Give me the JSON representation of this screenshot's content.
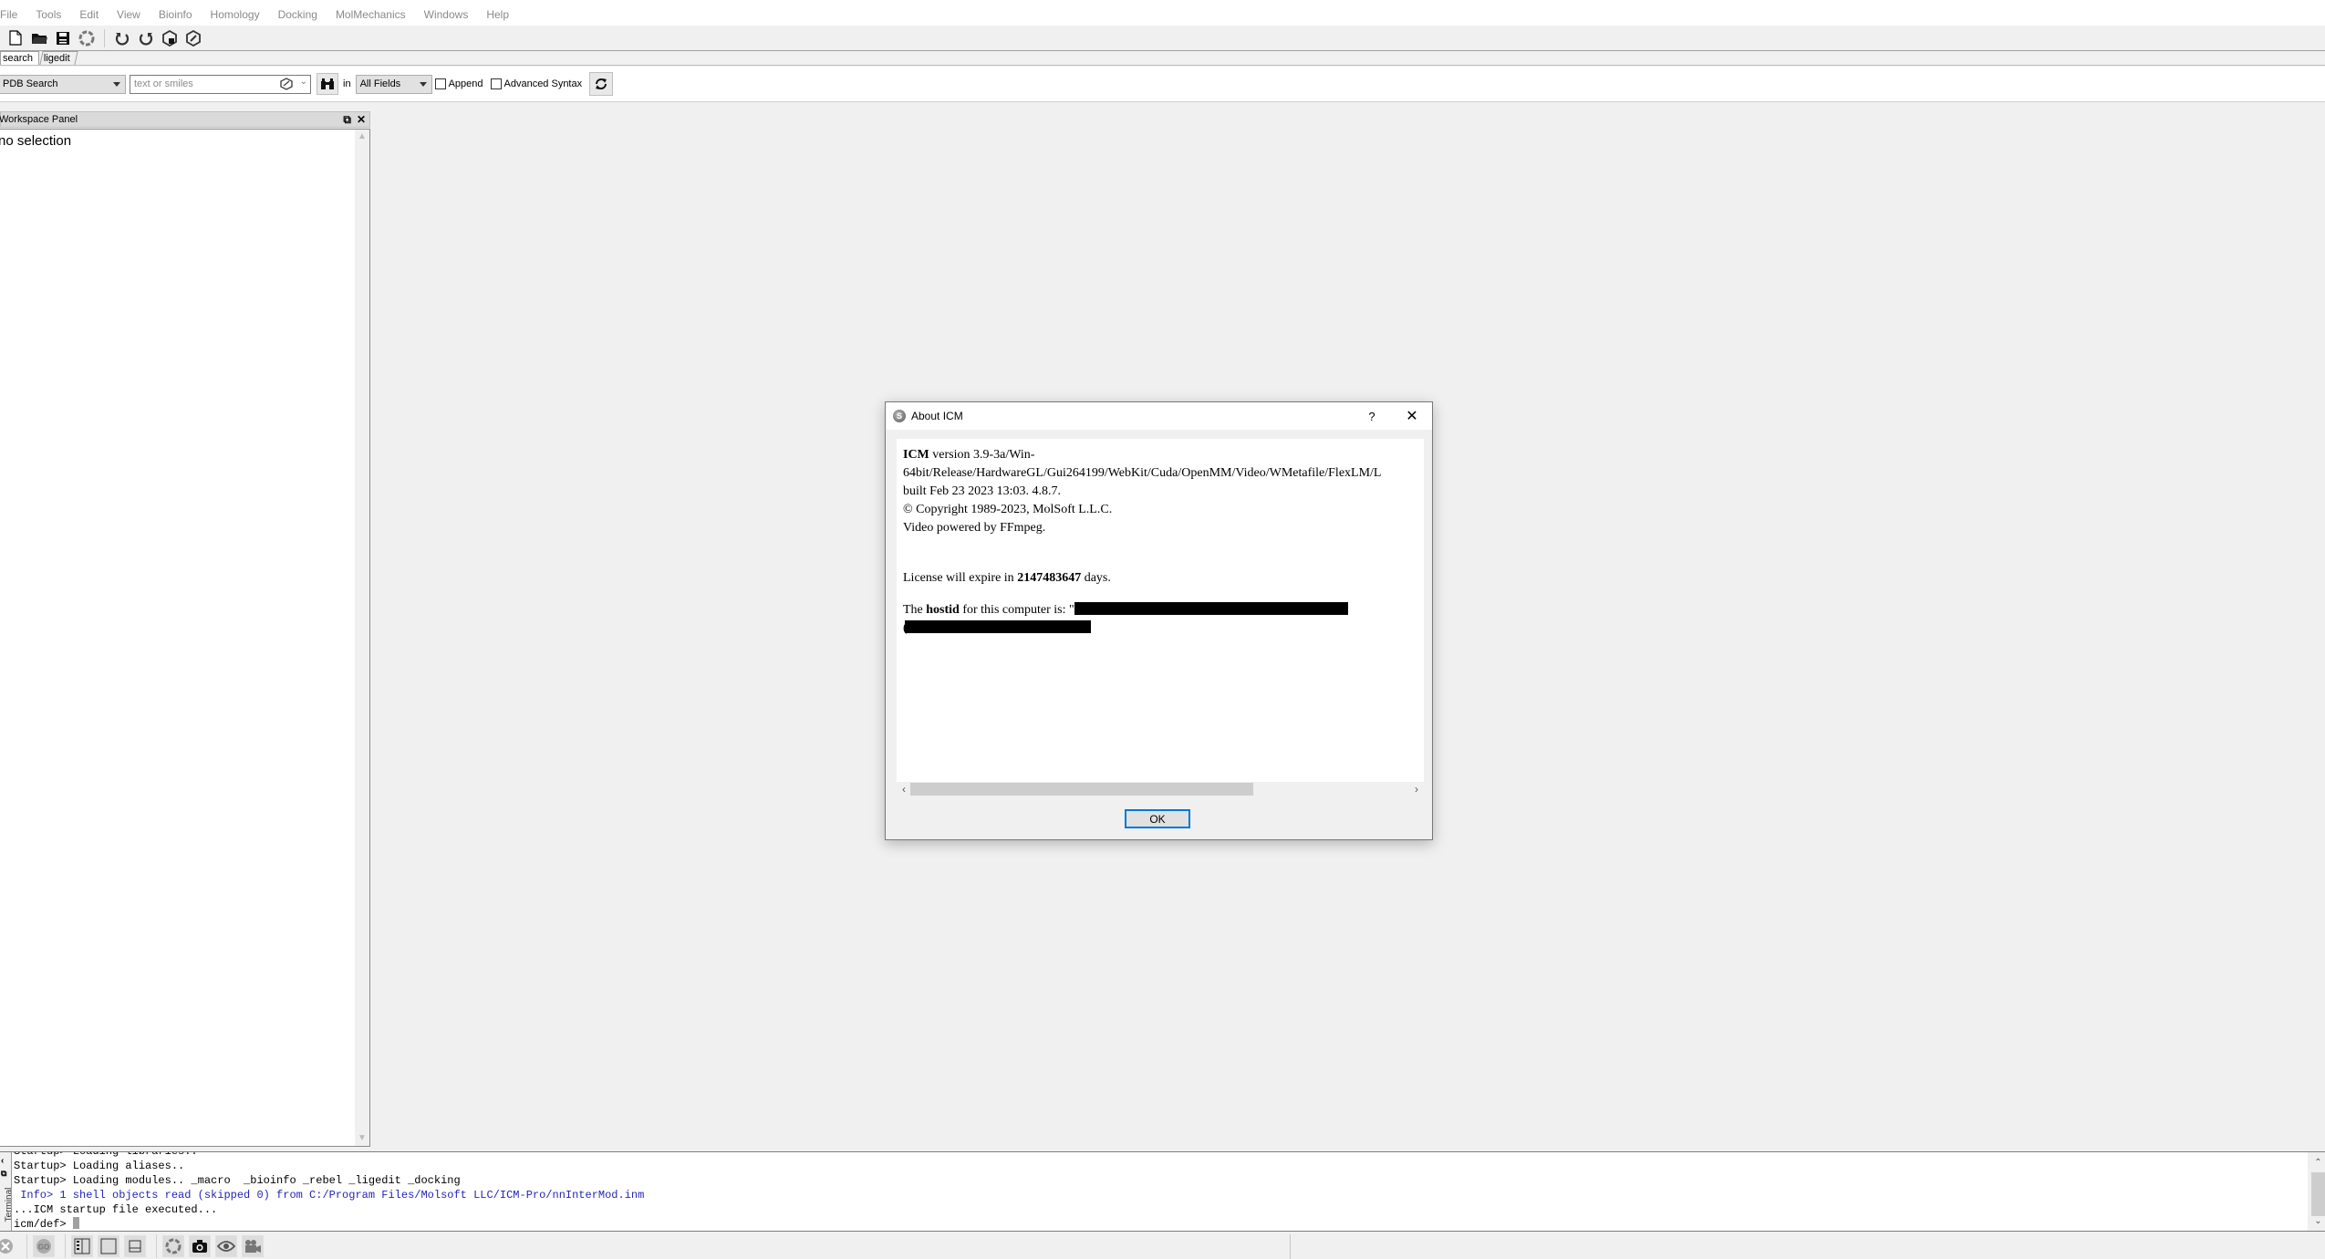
{
  "menubar": {
    "items": [
      "File",
      "Tools",
      "Edit",
      "View",
      "Bioinfo",
      "Homology",
      "Docking",
      "MolMechanics",
      "Windows",
      "Help"
    ]
  },
  "toolbar": {
    "icons": [
      "new-file-icon",
      "open-folder-icon",
      "save-icon",
      "molecule-icon",
      "undo-icon",
      "redo-icon",
      "search-structure-icon",
      "ligand-editor-icon"
    ]
  },
  "tabs": [
    {
      "label": "search",
      "active": true
    },
    {
      "label": "ligedit",
      "active": false
    }
  ],
  "search": {
    "source_selected": "PDB Search",
    "input_placeholder": "text or smiles",
    "input_value": "",
    "in_label": "in",
    "field_selected": "All Fields",
    "append_label": "Append",
    "append_checked": false,
    "advanced_label": "Advanced Syntax",
    "advanced_checked": false
  },
  "workspace": {
    "title": "Workspace Panel",
    "content": "no selection"
  },
  "dialog": {
    "title": "About ICM",
    "help_label": "?",
    "close_label": "✕",
    "line1_bold": "ICM",
    "line1_rest": " version 3.9-3a/Win-",
    "line2": "64bit/Release/HardwareGL/Gui264199/WebKit/Cuda/OpenMM/Video/WMetafile/FlexLM/L",
    "line3": "built Feb 23 2023 13:03. 4.8.7.",
    "line4": "© Copyright 1989-2023, MolSoft L.L.C.",
    "line5": "Video powered by FFmpeg.",
    "license_prefix": "License will expire in ",
    "license_days": "2147483647",
    "license_suffix": " days.",
    "hostid_prefix": "The ",
    "hostid_bold": "hostid",
    "hostid_rest": " for this computer is: \"",
    "hostid_line2_start": "(",
    "ok_label": "OK"
  },
  "terminal": {
    "side_label": "Terminal",
    "lines": [
      {
        "text": "Startup> Loading libraries..",
        "type": "normal"
      },
      {
        "text": "Startup> Loading aliases..",
        "type": "normal"
      },
      {
        "text": "Startup> Loading modules.. _macro  _bioinfo _rebel _ligedit _docking",
        "type": "normal"
      },
      {
        "text": " Info> 1 shell objects read (skipped 0) from C:/Program Files/Molsoft LLC/ICM-Pro/nnInterMod.inm",
        "type": "info"
      },
      {
        "text": "...ICM startup file executed...",
        "type": "normal"
      }
    ],
    "prompt": "icm/def> "
  },
  "bottombar": {
    "buttons": [
      "stop-icon",
      "go-icon",
      "panel-layout-icon",
      "fullscreen-icon",
      "split-view-icon",
      "rendering-icon",
      "camera-icon",
      "eye-icon",
      "movie-camera-icon"
    ]
  },
  "colors": {
    "info_text": "#2424b8",
    "ok_focus": "#0078d7"
  }
}
